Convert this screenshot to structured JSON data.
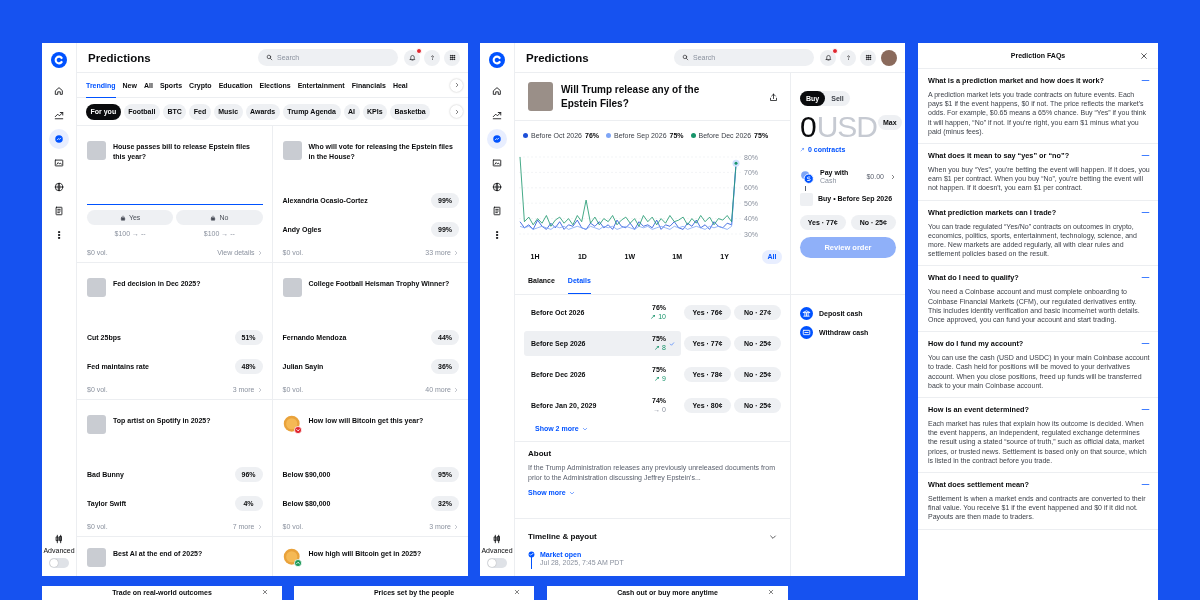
{
  "feed": {
    "header": {
      "title": "Predictions",
      "search_placeholder": "Search",
      "notifications_unread": true
    },
    "sidebar": {
      "items": [
        {
          "selected": false
        },
        {
          "selected": false
        },
        {
          "selected": true
        },
        {
          "selected": false
        },
        {
          "selected": false
        },
        {
          "selected": false
        },
        {
          "selected": false
        }
      ],
      "advanced_label": "Advanced",
      "advanced_on": false
    },
    "categories": [
      {
        "label": "Trending",
        "selected": true
      },
      {
        "label": "New",
        "selected": false
      },
      {
        "label": "All",
        "selected": false
      },
      {
        "label": "Sports",
        "selected": false
      },
      {
        "label": "Crypto",
        "selected": false
      },
      {
        "label": "Education",
        "selected": false
      },
      {
        "label": "Elections",
        "selected": false
      },
      {
        "label": "Entertainment",
        "selected": false
      },
      {
        "label": "Financials",
        "selected": false
      },
      {
        "label": "Heal",
        "selected": false
      }
    ],
    "chips": [
      {
        "label": "For you",
        "selected": true
      },
      {
        "label": "Football",
        "selected": false
      },
      {
        "label": "BTC",
        "selected": false
      },
      {
        "label": "Fed",
        "selected": false
      },
      {
        "label": "Music",
        "selected": false
      },
      {
        "label": "Awards",
        "selected": false
      },
      {
        "label": "Trump Agenda",
        "selected": false
      },
      {
        "label": "AI",
        "selected": false
      },
      {
        "label": "KPIs",
        "selected": false
      },
      {
        "label": "Basketba",
        "selected": false
      }
    ],
    "markets": [
      {
        "kind": "binary",
        "thumb": {
          "kind": "photo"
        },
        "title": "House passes bill to release Epstein files this year?",
        "options": [
          {
            "label": "Yes",
            "payout": "$100 → --"
          },
          {
            "label": "No",
            "payout": "$100 → --"
          }
        ],
        "volume": "$0 vol.",
        "link": "View details"
      },
      {
        "kind": "multi",
        "thumb": {
          "kind": "photo"
        },
        "title": "Who will vote for releasing the Epstein files in the House?",
        "outcomes": [
          {
            "name": "Alexandria Ocasio-Cortez",
            "chance": "99%"
          },
          {
            "name": "Andy Ogles",
            "chance": "99%"
          }
        ],
        "volume": "$0 vol.",
        "link": "33 more"
      },
      {
        "kind": "multi",
        "thumb": {
          "kind": "photo"
        },
        "title": "Fed decision in Dec 2025?",
        "outcomes": [
          {
            "name": "Cut 25bps",
            "chance": "51%"
          },
          {
            "name": "Fed maintains rate",
            "chance": "48%"
          }
        ],
        "volume": "$0 vol.",
        "link": "3 more"
      },
      {
        "kind": "multi",
        "thumb": {
          "kind": "photo"
        },
        "title": "College Football Heisman Trophy Winner?",
        "outcomes": [
          {
            "name": "Fernando Mendoza",
            "chance": "44%"
          },
          {
            "name": "Julian Sayin",
            "chance": "36%"
          }
        ],
        "volume": "$0 vol.",
        "link": "40 more"
      },
      {
        "kind": "multi",
        "thumb": {
          "kind": "photo"
        },
        "title": "Top artist on Spotify in 2025?",
        "outcomes": [
          {
            "name": "Bad Bunny",
            "chance": "96%"
          },
          {
            "name": "Taylor Swift",
            "chance": "4%"
          }
        ],
        "volume": "$0 vol.",
        "link": "7 more"
      },
      {
        "kind": "multi",
        "thumb": {
          "kind": "coin",
          "rising": false
        },
        "title": "How low will Bitcoin get this year?",
        "outcomes": [
          {
            "name": "Below $90,000",
            "chance": "95%"
          },
          {
            "name": "Below $80,000",
            "chance": "32%"
          }
        ],
        "volume": "$0 vol.",
        "link": "3 more"
      },
      {
        "kind": "multi",
        "thumb": {
          "kind": "photo"
        },
        "title": "Best AI at the end of 2025?"
      },
      {
        "kind": "multi",
        "thumb": {
          "kind": "coin",
          "rising": true
        },
        "title": "How high will Bitcoin get in 2025?"
      }
    ]
  },
  "detail": {
    "header": {
      "title": "Predictions",
      "search_placeholder": "Search",
      "notifications_unread": true,
      "avatar": true
    },
    "sidebar": {
      "items": [
        {
          "selected": false
        },
        {
          "selected": false
        },
        {
          "selected": true
        },
        {
          "selected": false
        },
        {
          "selected": false
        },
        {
          "selected": false
        },
        {
          "selected": false
        }
      ],
      "advanced_label": "Advanced",
      "advanced_on": false
    },
    "title": "Will Trump release any of the Epstein Files?",
    "legend_values": [
      "76%",
      "75%",
      "75%"
    ],
    "chart_data": {
      "type": "line",
      "grid": true,
      "ylim": [
        30,
        80
      ],
      "yticks": [
        {
          "value": 80,
          "label": "80%"
        },
        {
          "value": 70,
          "label": "70%"
        },
        {
          "value": 60,
          "label": "60%"
        },
        {
          "value": 50,
          "label": "50%"
        },
        {
          "value": 40,
          "label": "40%"
        },
        {
          "value": 30,
          "label": "30%"
        }
      ],
      "series": [
        {
          "name": "Before Oct 2026",
          "color": "#1d4fd8",
          "values": [
            38,
            34,
            36,
            33,
            39,
            35,
            33,
            37,
            34,
            38,
            33,
            36,
            35,
            39,
            34,
            33,
            37,
            35,
            38,
            34,
            36,
            33,
            39,
            35,
            34,
            37,
            33,
            38,
            35,
            36,
            34,
            39,
            33,
            36,
            35,
            38,
            34,
            33,
            37,
            35,
            39,
            34,
            36,
            33,
            38,
            35,
            34,
            37,
            36,
            76
          ]
        },
        {
          "name": "Before Sep 2026",
          "color": "#7ea5f6",
          "values": [
            35,
            34,
            35,
            33,
            34,
            35,
            34,
            33,
            35,
            34,
            35,
            33,
            34,
            35,
            34,
            33,
            35,
            34,
            33,
            35,
            34,
            35,
            33,
            34,
            35,
            34,
            33,
            35,
            34,
            35,
            33,
            34,
            35,
            34,
            33,
            35,
            34,
            35,
            33,
            34,
            35,
            34,
            33,
            35,
            34,
            35,
            34,
            33,
            35,
            75
          ]
        },
        {
          "name": "Before Dec 2026",
          "color": "#17946a",
          "values": [
            80,
            38,
            41,
            36,
            40,
            37,
            42,
            35,
            39,
            41,
            37,
            40,
            36,
            42,
            38,
            52,
            37,
            41,
            36,
            40,
            38,
            42,
            36,
            39,
            41,
            37,
            40,
            35,
            42,
            38,
            41,
            36,
            40,
            37,
            42,
            38,
            39,
            41,
            36,
            40,
            37,
            42,
            38,
            41,
            36,
            40,
            39,
            42,
            38,
            75
          ]
        }
      ]
    },
    "ranges": [
      {
        "label": "1H",
        "selected": false
      },
      {
        "label": "1D",
        "selected": false
      },
      {
        "label": "1W",
        "selected": false
      },
      {
        "label": "1M",
        "selected": false
      },
      {
        "label": "1Y",
        "selected": false
      },
      {
        "label": "All",
        "selected": true
      }
    ],
    "tabs": [
      {
        "label": "Balance",
        "selected": false
      },
      {
        "label": "Details",
        "selected": true
      }
    ],
    "outcomes": [
      {
        "name": "Before Oct 2026",
        "chance": "76%",
        "change": "↗ 10",
        "rising": true,
        "yes": "Yes · 76¢",
        "no": "No · 27¢",
        "selected": false
      },
      {
        "name": "Before Sep 2026",
        "chance": "75%",
        "change": "↗ 8",
        "rising": true,
        "yes": "Yes · 77¢",
        "no": "No · 25¢",
        "selected": true
      },
      {
        "name": "Before Dec 2026",
        "chance": "75%",
        "change": "↗ 9",
        "rising": true,
        "yes": "Yes · 78¢",
        "no": "No · 25¢",
        "selected": false
      },
      {
        "name": "Before Jan 20, 2029",
        "chance": "74%",
        "change": "→ 0",
        "rising": false,
        "yes": "Yes · 80¢",
        "no": "No · 25¢",
        "selected": false
      }
    ],
    "show_more": "Show 2 more",
    "about": {
      "heading": "About",
      "text": "If the Trump Administration releases any previously unreleased documents from prior to the Administration discussing Jeffrey Epstein's...",
      "show_more": "Show more"
    },
    "timeline": {
      "heading": "Timeline & payout",
      "events": [
        {
          "label": "Market open",
          "date": "Jul 28, 2025, 7:45 AM PDT"
        }
      ]
    },
    "trade": {
      "sides": [
        {
          "label": "Buy",
          "selected": true
        },
        {
          "label": "Sell",
          "selected": false
        }
      ],
      "amount": "0",
      "currency": "USD",
      "max": "Max",
      "contracts": "0 contracts",
      "pay_label": "Pay with",
      "pay_method": "Cash",
      "pay_amount": "$0.00",
      "order": "Buy • Before Sep 2026",
      "yes": "Yes · 77¢",
      "no": "No · 25¢",
      "review": "Review order",
      "review_disabled": true,
      "actions": [
        "Deposit cash",
        "Withdraw cash"
      ]
    }
  },
  "faq": {
    "title": "Prediction FAQs",
    "items": [
      {
        "question": "What is a prediction market and how does it work?",
        "answer": "A prediction market lets you trade contracts on future events. Each pays $1 if the event happens, $0 if not. The price reflects the market's odds. For example, $0.65 means a 65% chance. Buy “Yes” if you think it will happen, “No” if not. If you're right, you earn $1 minus what you paid (minus fees).",
        "expanded": true
      },
      {
        "question": "What does it mean to say “yes” or “no”?",
        "answer": "When you buy “Yes”, you're betting the event will happen. If it does, you earn $1 per contract. When you buy “No”, you're betting the event will not happen. If it doesn't, you earn $1 per contract.",
        "expanded": true
      },
      {
        "question": "What prediction markets can I trade?",
        "answer": "You can trade regulated “Yes/No” contracts on outcomes in crypto, economics, politics, sports, entertainment, technology, science, and more. New markets are added regularly, all with clear rules and settlement policies based on the result.",
        "expanded": true
      },
      {
        "question": "What do I need to qualify?",
        "answer": "You need a Coinbase account and must complete onboarding to Coinbase Financial Markets (CFM), our regulated derivatives entity. This includes identity verification and basic income/net worth details. Once approved, you can fund your account and start trading.",
        "expanded": true
      },
      {
        "question": "How do I fund my account?",
        "answer": "You can use the cash (USD and USDC) in your main Coinbase account to trade. Cash held for positions will be moved to your derivatives account. When you close positions, freed up funds will be transferred back to your main Coinbase account.",
        "expanded": true
      },
      {
        "question": "How is an event determined?",
        "answer": "Each market has rules that explain how its outcome is decided. When the event happens, an independent, regulated exchange determines the result using a stated “source of truth,” such as official data, market prices, or trusted news. Settlement is based only on that source, which is listed in the contract before you trade.",
        "expanded": true
      },
      {
        "question": "What does settlement mean?",
        "answer": "Settlement is when a market ends and contracts are converted to their final value. You receive $1 if the event happened and $0 if it did not. Payouts are then made to traders.",
        "expanded": true
      }
    ]
  },
  "tips": [
    "Trade on real-world outcomes",
    "Prices set by the people",
    "Cash out or buy more anytime"
  ]
}
